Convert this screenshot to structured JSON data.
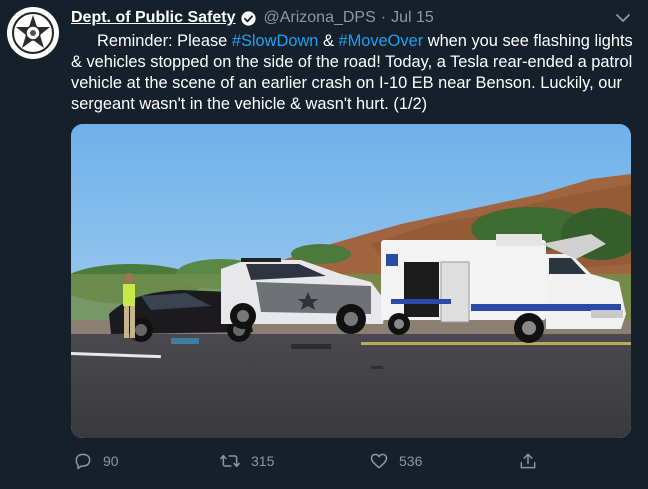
{
  "tweet": {
    "author_name": "Dept. of Public Safety",
    "handle": "@Arizona_DPS",
    "separator": "·",
    "time": "Jul 15",
    "text_parts": [
      "Reminder: Please ",
      "#SlowDown",
      " & ",
      "#MoveOver",
      " when you see flashing lights & vehicles stopped on the side of the road! Today, a Tesla rear-ended a patrol vehicle at the scene of an earlier crash on I-10 EB near Benson. Luckily, our sergeant wasn't in the vehicle & wasn't hurt. (1/2)"
    ],
    "media": {
      "description_icons": [
        "ambulance",
        "patrol-car",
        "sedan",
        "officer"
      ]
    },
    "actions": {
      "replies": "90",
      "retweets": "315",
      "likes": "536"
    }
  },
  "colors": {
    "background": "#15202b",
    "text": "#ffffff",
    "secondary": "#8899a6",
    "hashtag": "#1da1f2"
  },
  "icons": {
    "verified": "verified-badge-icon",
    "caret": "chevron-down-icon",
    "reply": "reply-icon",
    "retweet": "retweet-icon",
    "like": "heart-icon",
    "share": "share-icon"
  }
}
